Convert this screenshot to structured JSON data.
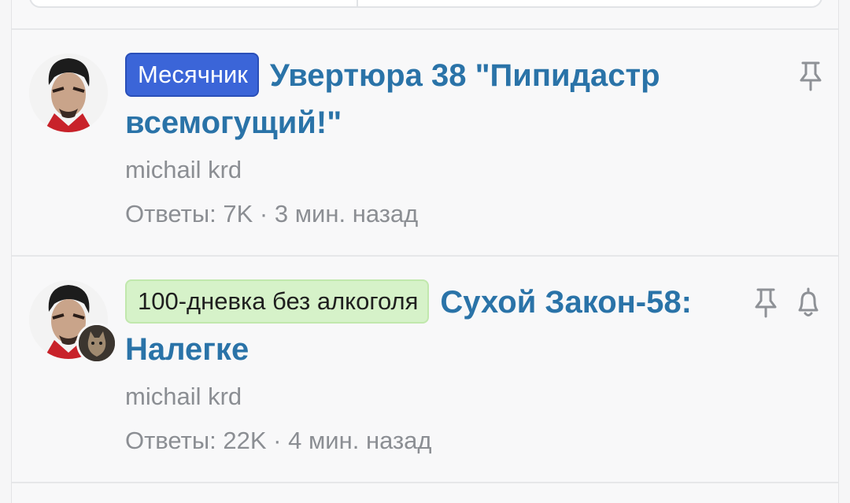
{
  "threads": [
    {
      "prefix": "Месячник",
      "title": "Увертюра 38 \"Пипидастр всемогущий!\"",
      "author": "michail krd",
      "replies_label": "Ответы:",
      "replies_count": "7K",
      "separator": "·",
      "time": "3 мин. назад",
      "icons": [
        "pin-icon"
      ]
    },
    {
      "prefix": "100-дневка без алкоголя",
      "title": "Сухой Закон-58: Налегке",
      "author": "michail krd",
      "replies_label": "Ответы:",
      "replies_count": "22K",
      "separator": "·",
      "time": "4 мин. назад",
      "icons": [
        "pin-icon",
        "bell-icon"
      ]
    }
  ],
  "colors": {
    "title": "#2a73a8",
    "prefix_blue": "#3b65d8",
    "prefix_green": "#d6f2c9",
    "meta": "#8b8e93"
  }
}
